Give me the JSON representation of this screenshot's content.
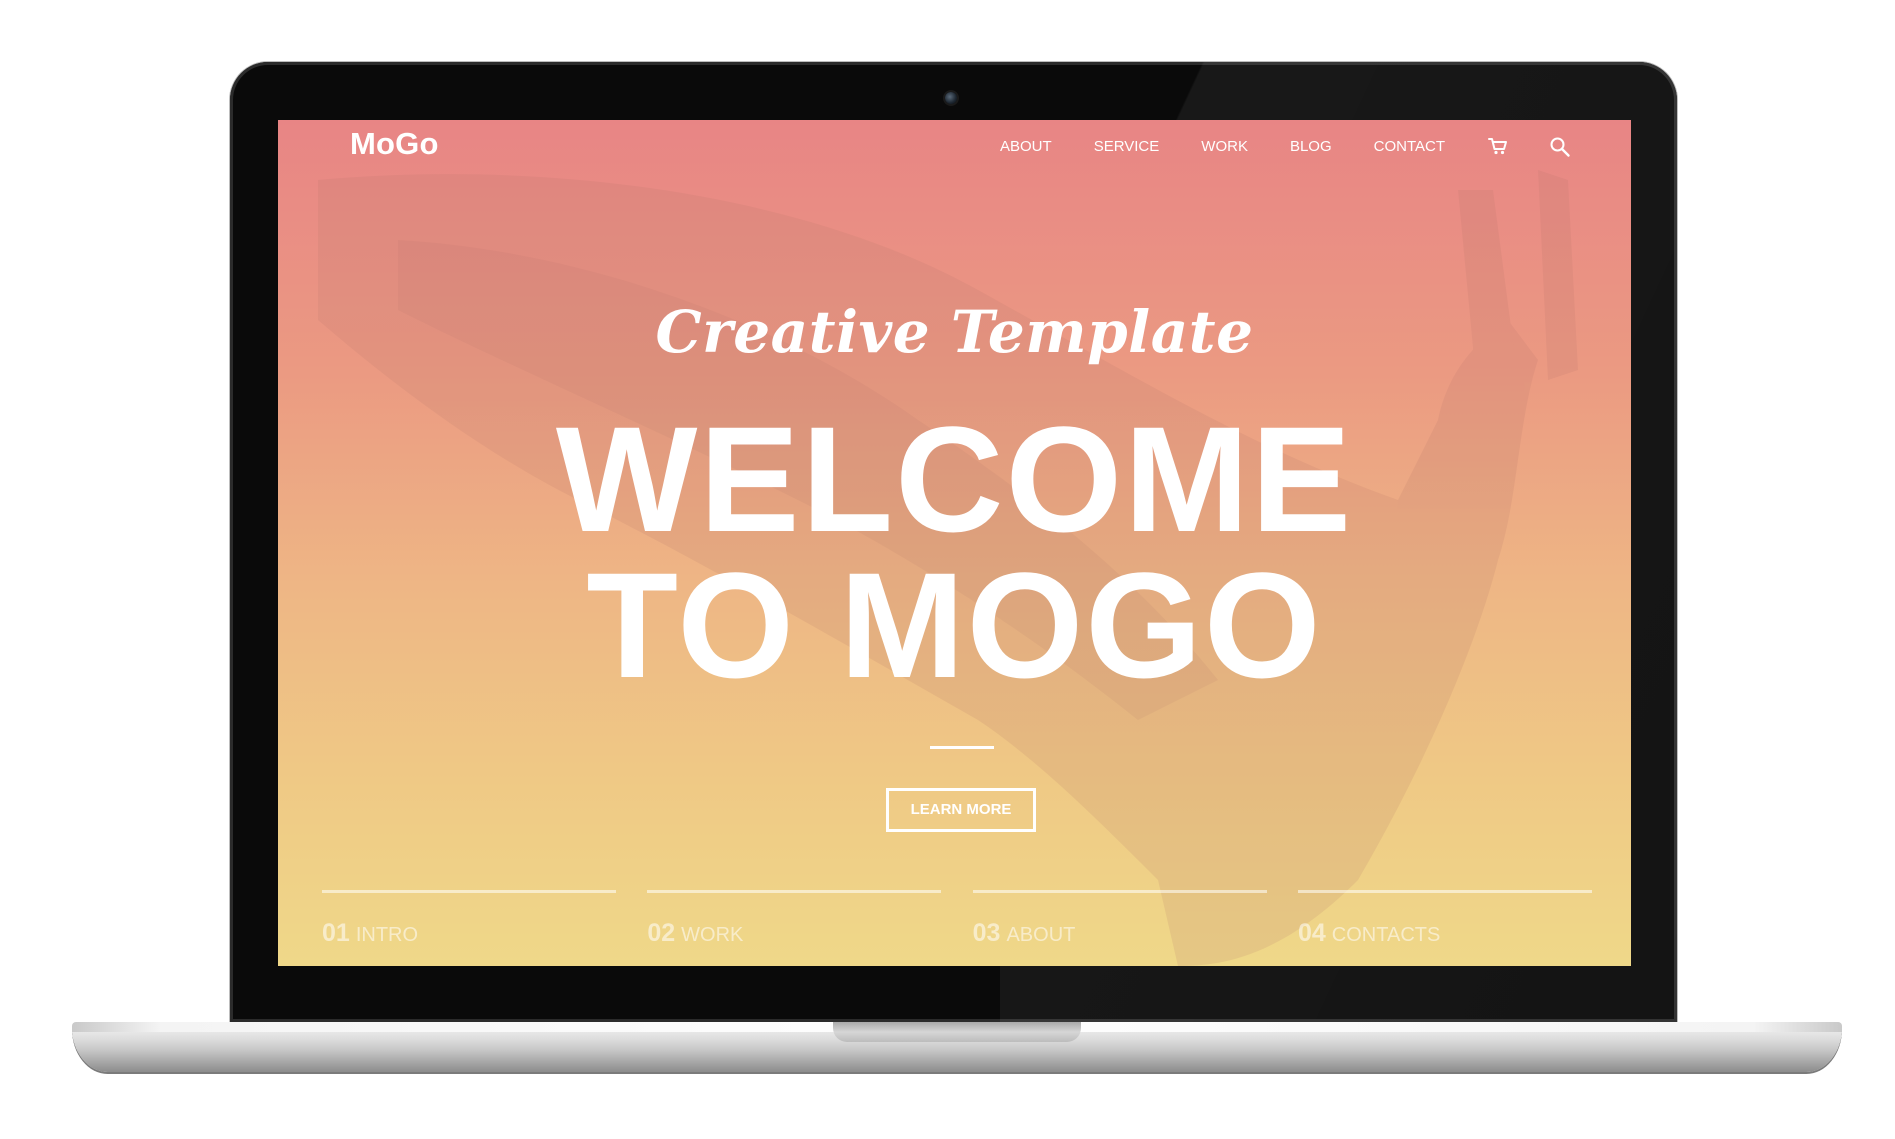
{
  "brand": {
    "logo": "MoGo"
  },
  "nav": {
    "items": [
      {
        "label": "ABOUT"
      },
      {
        "label": "SERVICE"
      },
      {
        "label": "WORK"
      },
      {
        "label": "BLOG"
      },
      {
        "label": "CONTACT"
      }
    ],
    "icons": [
      "cart-icon",
      "search-icon"
    ]
  },
  "hero": {
    "script_title": "Creative Template",
    "headline_line1": "WELCOME",
    "headline_line2": "TO MOGO",
    "button_label": "LEARN MORE"
  },
  "slides": [
    {
      "num": "01",
      "label": "INTRO"
    },
    {
      "num": "02",
      "label": "WORK"
    },
    {
      "num": "03",
      "label": "ABOUT"
    },
    {
      "num": "04",
      "label": "CONTACTS"
    }
  ],
  "colors": {
    "gradient_top": "#e88585",
    "gradient_bottom": "#efd889",
    "text": "#ffffff",
    "bezel": "#0a0a0a"
  }
}
